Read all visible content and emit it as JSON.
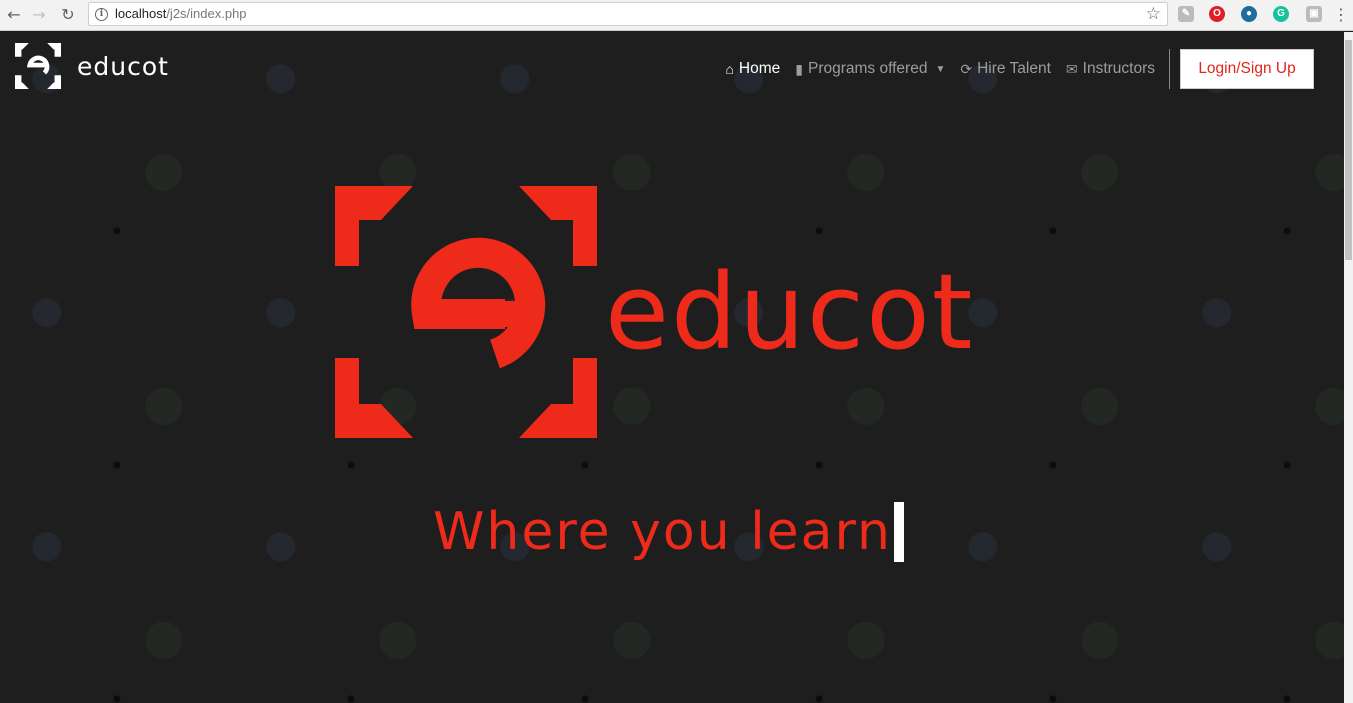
{
  "browser": {
    "url_host": "localhost",
    "url_path": "/j2s/index.php",
    "icons": [
      "back-icon",
      "forward-icon",
      "reload-icon",
      "info-icon",
      "star-icon",
      "menu-icon"
    ],
    "extensions": [
      "pdf-extension-icon",
      "opera-icon",
      "earth-icon",
      "grammarly-icon",
      "pane-extension-icon"
    ]
  },
  "brand": {
    "name": "educot",
    "logo_letter": "e"
  },
  "nav": {
    "items": [
      {
        "label": "Home",
        "icon": "home-icon",
        "active": true
      },
      {
        "label": "Programs offered",
        "icon": "book-icon",
        "dropdown": true
      },
      {
        "label": "Hire Talent",
        "icon": "refresh-icon"
      },
      {
        "label": "Instructors",
        "icon": "envelope-icon"
      }
    ],
    "login_label": "Login/Sign Up"
  },
  "hero": {
    "name": "educot",
    "tagline": "Where you learn"
  },
  "colors": {
    "accent": "#ee2a1b",
    "background": "#1e1e1e",
    "nav_text": "#9d9d9d"
  }
}
